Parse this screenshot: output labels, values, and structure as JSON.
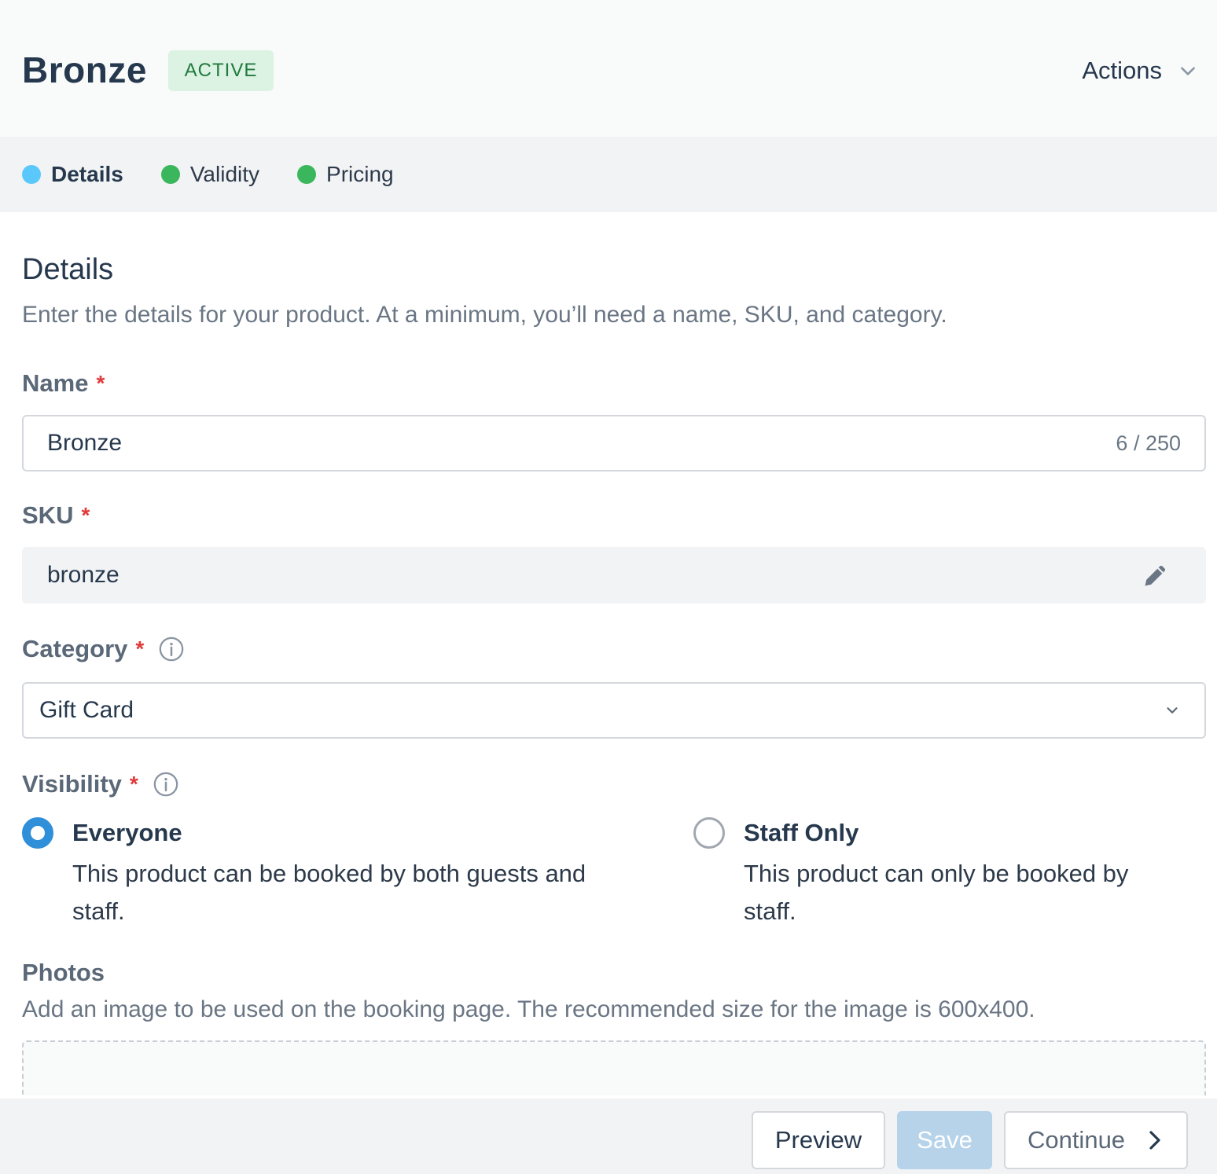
{
  "header": {
    "title": "Bronze",
    "status_badge": "ACTIVE",
    "actions_label": "Actions"
  },
  "steps": [
    {
      "label": "Details",
      "color": "#5ac8fa",
      "active": true
    },
    {
      "label": "Validity",
      "color": "#3ab65c",
      "active": false
    },
    {
      "label": "Pricing",
      "color": "#3ab65c",
      "active": false
    }
  ],
  "section": {
    "title": "Details",
    "description": "Enter the details for your product. At a minimum, you’ll need a name, SKU, and category."
  },
  "fields": {
    "name": {
      "label": "Name",
      "required_mark": "*",
      "value": "Bronze",
      "counter": "6 / 250"
    },
    "sku": {
      "label": "SKU",
      "required_mark": "*",
      "value": "bronze"
    },
    "category": {
      "label": "Category",
      "required_mark": "*",
      "value": "Gift Card"
    },
    "visibility": {
      "label": "Visibility",
      "required_mark": "*",
      "options": [
        {
          "title": "Everyone",
          "description": "This product can be booked by both guests and staff.",
          "selected": true
        },
        {
          "title": "Staff Only",
          "description": "This product can only be booked by staff.",
          "selected": false
        }
      ]
    }
  },
  "photos": {
    "label": "Photos",
    "description": "Add an image to be used on the booking page. The recommended size for the image is 600x400."
  },
  "footer": {
    "preview_label": "Preview",
    "save_label": "Save",
    "continue_label": "Continue"
  },
  "colors": {
    "accent": "#2f8fd8",
    "required": "#e03a3a",
    "badge_bg": "#dcf2e3",
    "badge_text": "#1f7a3c"
  }
}
